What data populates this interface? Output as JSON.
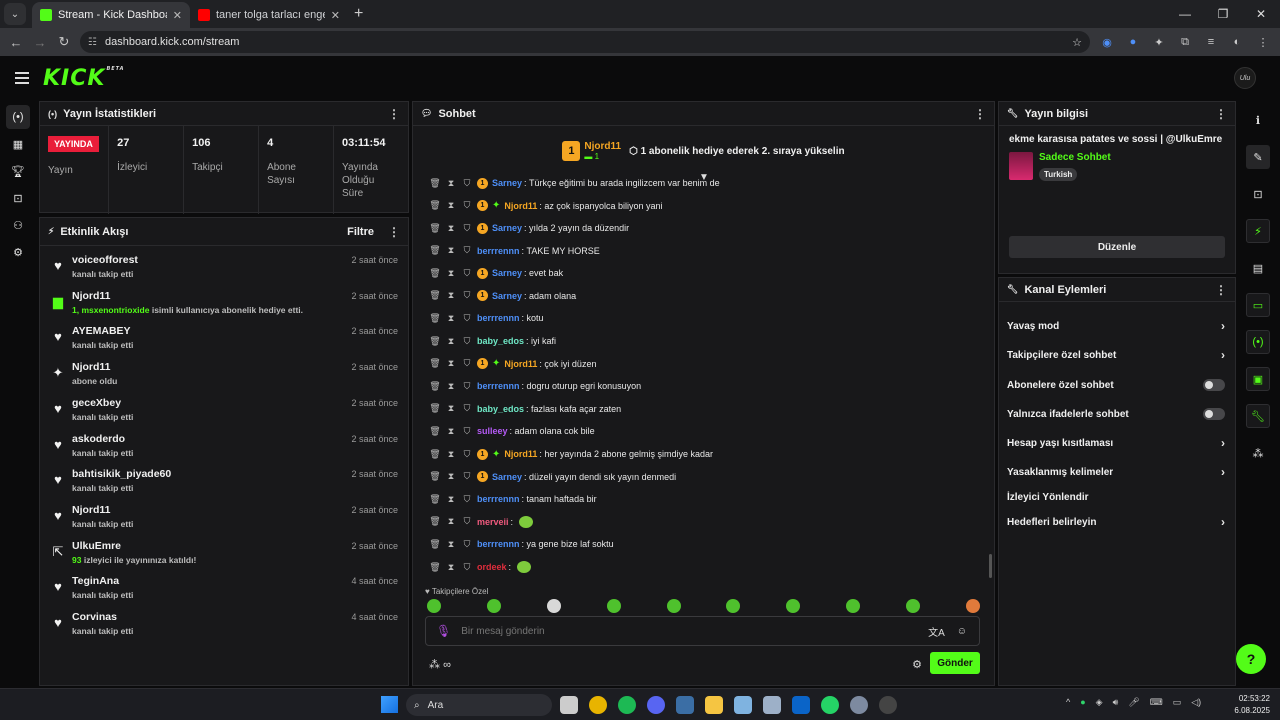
{
  "browser": {
    "tabs": [
      {
        "title": "Stream - Kick Dashboard",
        "active": true,
        "fav_color": "#53fc18"
      },
      {
        "title": "taner tolga tarlacı engelli hayra",
        "active": false,
        "fav_color": "#ff0000"
      }
    ],
    "url": "dashboard.kick.com/stream"
  },
  "header": {
    "logo": "KICK",
    "beta": "BETA",
    "avatar_text": "Ulu"
  },
  "stats_panel": {
    "title": "Yayın İstatistikleri",
    "live_badge": "YAYINDA",
    "items": [
      {
        "value": "",
        "label": "Yayın"
      },
      {
        "value": "27",
        "label": "İzleyici"
      },
      {
        "value": "106",
        "label": "Takipçi"
      },
      {
        "value": "4",
        "label": "Abone Sayısı"
      },
      {
        "value": "03:11:54",
        "label": "Yayında Olduğu Süre"
      }
    ]
  },
  "activity": {
    "title": "Etkinlik Akışı",
    "filter": "Filtre",
    "items": [
      {
        "icon": "heart",
        "name": "voiceofforest",
        "sub": "kanalı takip etti",
        "time": "2 saat önce"
      },
      {
        "icon": "gift",
        "name": "Njord11",
        "sub_highlight": "1, msxenontrioxide",
        "sub": "isimli kullanıcıya abonelik hediye etti.",
        "time": "2 saat önce"
      },
      {
        "icon": "heart",
        "name": "AYEMABEY",
        "sub": "kanalı takip etti",
        "time": "2 saat önce"
      },
      {
        "icon": "star",
        "name": "Njord11",
        "sub": "abone oldu",
        "time": "2 saat önce"
      },
      {
        "icon": "heart",
        "name": "geceXbey",
        "sub": "kanalı takip etti",
        "time": "2 saat önce"
      },
      {
        "icon": "heart",
        "name": "askoderdo",
        "sub": "kanalı takip etti",
        "time": "2 saat önce"
      },
      {
        "icon": "heart",
        "name": "bahtisikik_piyade60",
        "sub": "kanalı takip etti",
        "time": "2 saat önce"
      },
      {
        "icon": "heart",
        "name": "Njord11",
        "sub": "kanalı takip etti",
        "time": "2 saat önce"
      },
      {
        "icon": "raid",
        "name": "UlkuEmre",
        "sub_highlight": "93",
        "sub": "izleyici ile yayınınıza katıldı!",
        "time": "2 saat önce"
      },
      {
        "icon": "heart",
        "name": "TeginAna",
        "sub": "kanalı takip etti",
        "time": "4 saat önce"
      },
      {
        "icon": "heart",
        "name": "Corvinas",
        "sub": "kanalı takip etti",
        "time": "4 saat önce"
      }
    ]
  },
  "chat": {
    "title": "Sohbet",
    "pinned": {
      "badge": "1",
      "user": "Njord11",
      "count": "1",
      "message": "1 abonelik hediye ederek 2. sıraya yükselin"
    },
    "messages": [
      {
        "user": "Sarney",
        "color": "#4e8ff7",
        "sub": true,
        "og": false,
        "text": "yılda 2 yayın da düzendir"
      },
      {
        "user": "berrrennn",
        "color": "#4e8ff7",
        "sub": false,
        "og": false,
        "text": "TAKE MY HORSE"
      },
      {
        "user": "Sarney",
        "color": "#4e8ff7",
        "sub": true,
        "og": false,
        "text": "evet bak"
      },
      {
        "user": "Sarney",
        "color": "#4e8ff7",
        "sub": true,
        "og": false,
        "text": "adam olana"
      },
      {
        "user": "berrrennn",
        "color": "#4e8ff7",
        "sub": false,
        "og": false,
        "text": "kotu"
      },
      {
        "user": "baby_edos",
        "color": "#6fe8c6",
        "sub": false,
        "og": false,
        "text": "iyi kafi"
      },
      {
        "user": "Njord11",
        "color": "#f5a623",
        "sub": true,
        "og": true,
        "text": "çok iyi düzen"
      },
      {
        "user": "berrrennn",
        "color": "#4e8ff7",
        "sub": false,
        "og": false,
        "text": "dogru oturup egri konusuyon"
      },
      {
        "user": "baby_edos",
        "color": "#6fe8c6",
        "sub": false,
        "og": false,
        "text": "fazlası kafa açar zaten"
      },
      {
        "user": "sulleey",
        "color": "#b45af5",
        "sub": false,
        "og": false,
        "text": "adam olana cok bile"
      },
      {
        "user": "Njord11",
        "color": "#f5a623",
        "sub": true,
        "og": true,
        "text": "her yayında 2 abone gelmiş şimdiye kadar"
      },
      {
        "user": "Sarney",
        "color": "#4e8ff7",
        "sub": true,
        "og": false,
        "text": "düzeli yayın dendi sık yayın denmedi"
      },
      {
        "user": "berrrennn",
        "color": "#4e8ff7",
        "sub": false,
        "og": false,
        "text": "tanam haftada bir"
      },
      {
        "user": "merveii",
        "color": "#f05a7e",
        "sub": false,
        "og": false,
        "text": ""
      },
      {
        "user": "berrrennn",
        "color": "#4e8ff7",
        "sub": false,
        "og": false,
        "text": "ya gene bize laf soktu"
      },
      {
        "user": "ordeek",
        "color": "#e02d3c",
        "sub": false,
        "og": false,
        "text": ""
      }
    ],
    "first_line": {
      "user": "Sarney",
      "color": "#4e8ff7",
      "text": "Türkçe  eğitimi bu arada ingilizcem var benim de"
    },
    "second_line": {
      "user": "Njord11",
      "color": "#f5a623",
      "text": "az çok ispanyolca biliyon yani"
    },
    "followers_only": "Takipçilere Özel",
    "input_placeholder": "Bir mesaj gönderin",
    "send": "Gönder"
  },
  "stream_info": {
    "title": "Yayın bilgisi",
    "stream_title": "ekme karasısa patates ve sossi | @UlkuEmre",
    "category": "Sadece Sohbet",
    "tag": "Turkish",
    "edit": "Düzenle"
  },
  "channel_actions": {
    "title": "Kanal Eylemleri",
    "items": [
      {
        "label": "Yavaş mod",
        "type": "chevron"
      },
      {
        "label": "Takipçilere özel sohbet",
        "type": "chevron"
      },
      {
        "label": "Abonelere özel sohbet",
        "type": "toggle"
      },
      {
        "label": "Yalnızca ifadelerle sohbet",
        "type": "toggle"
      },
      {
        "label": "Hesap yaşı kısıtlaması",
        "type": "chevron"
      },
      {
        "label": "Yasaklanmış kelimeler",
        "type": "chevron"
      },
      {
        "label": "İzleyici Yönlendir",
        "type": "none"
      },
      {
        "label": "Hedefleri belirleyin",
        "type": "chevron"
      }
    ]
  },
  "taskbar": {
    "search": "Ara",
    "time": "02:53:22",
    "date": "6.08.2025"
  }
}
